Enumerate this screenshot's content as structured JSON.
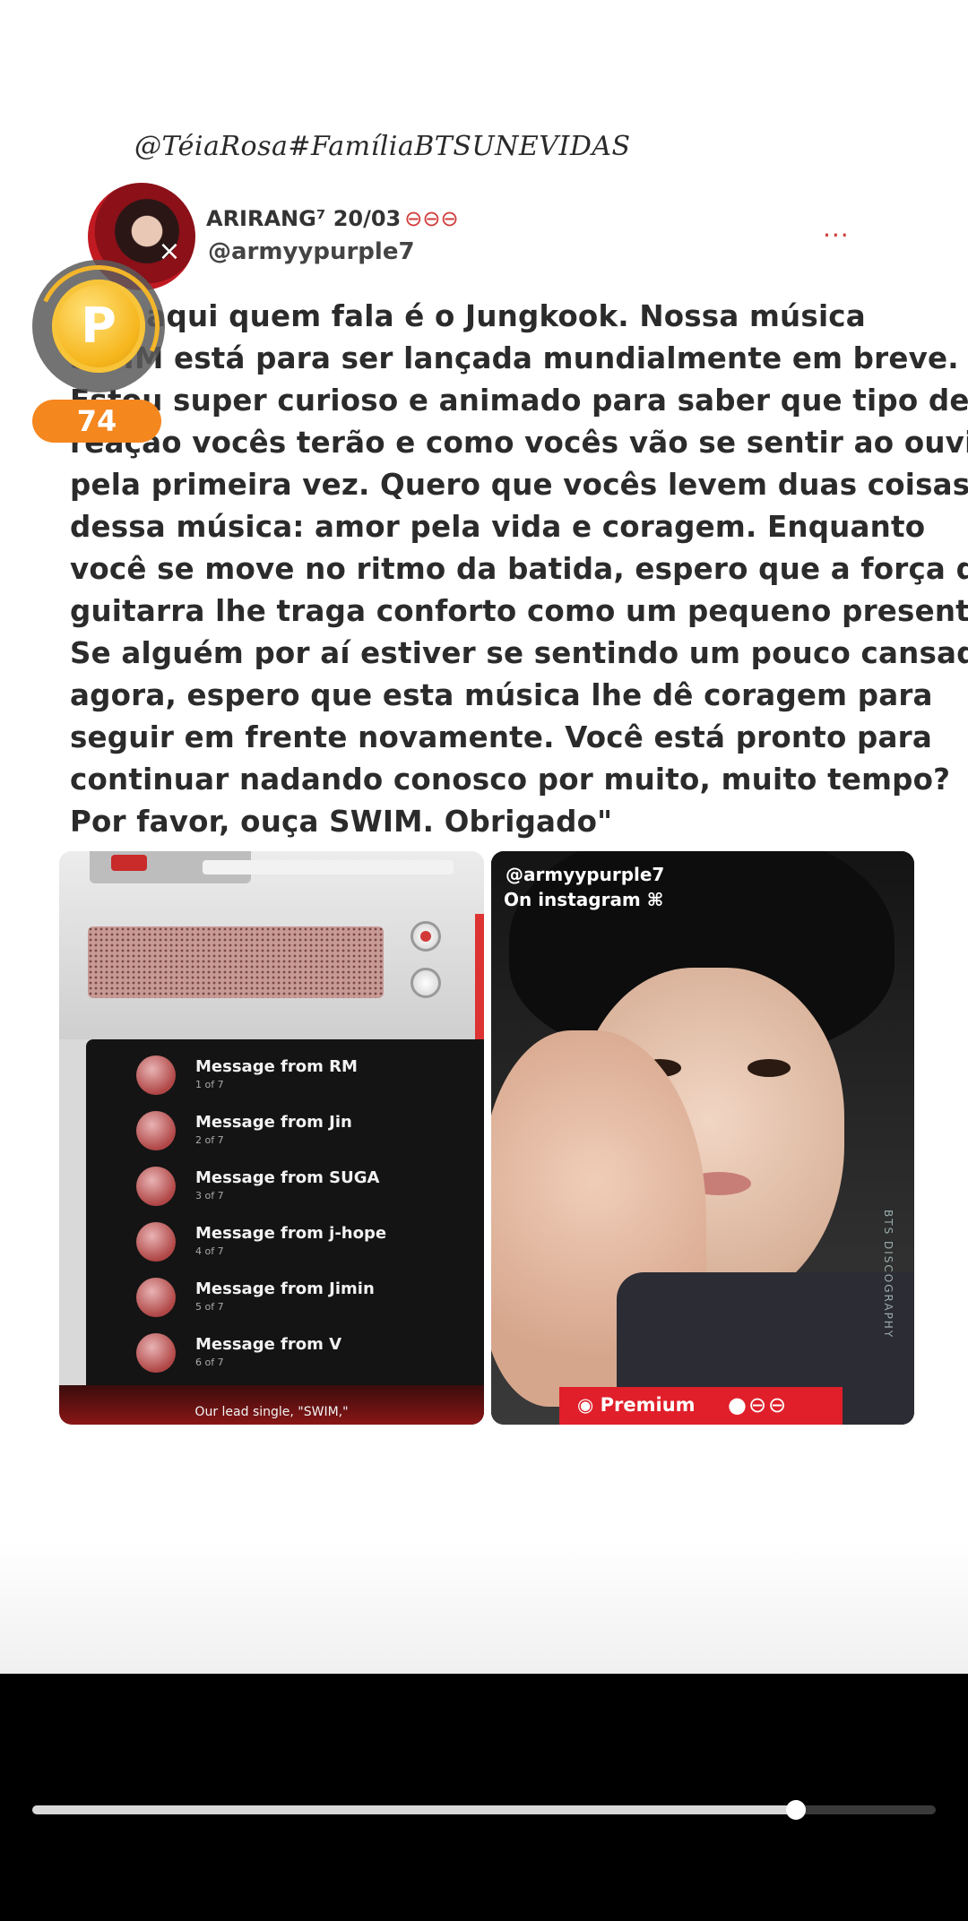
{
  "watermark": "@TéiaRosa#FamíliaBTSUNEVIDAS",
  "post": {
    "author": "ARIRANG⁷ 20/03",
    "author_emojis": "⊖⊖⊖",
    "handle": "@armyypurple7",
    "more": "...",
    "body_lines": [
      "Olá, aqui quem fala é o Jungkook. Nossa música",
      "SWIM está para ser lançada mundialmente em breve.",
      "Estou super curioso e animado para saber que tipo de",
      "reação vocês terão e como vocês vão se sentir ao ouvi-la",
      "pela primeira vez. Quero que vocês levem duas coisas",
      "dessa música: amor pela vida e coragem. Enquanto",
      "você se move no ritmo da batida, espero que a força da",
      "guitarra lhe traga conforto como um pequeno presente.",
      "Se alguém por aí estiver se sentindo um pouco cansado",
      "agora, espero que esta música lhe dê coragem para",
      "seguir em frente novamente. Você está pronto para",
      "continuar nadando conosco por muito, muito tempo?",
      "Por favor, ouça SWIM. Obrigado\""
    ]
  },
  "coin": {
    "symbol": "P",
    "count": "74"
  },
  "media_left": {
    "messages": [
      {
        "title": "Message from RM",
        "sub": "1 of 7"
      },
      {
        "title": "Message from Jin",
        "sub": "2 of 7"
      },
      {
        "title": "Message from SUGA",
        "sub": "3 of 7"
      },
      {
        "title": "Message from j-hope",
        "sub": "4 of 7"
      },
      {
        "title": "Message from Jimin",
        "sub": "5 of 7"
      },
      {
        "title": "Message from V",
        "sub": "6 of 7"
      }
    ],
    "footer": "Our lead single, \"SWIM,\""
  },
  "media_right": {
    "handle": "@armyypurple7",
    "subtitle": "On instagram ⌘",
    "premium": "Premium",
    "premium_icons": "●⊖⊖",
    "vertical": "BTS DISCOGRAPHY"
  },
  "player": {
    "progress_fraction": 0.845
  },
  "colors": {
    "accent_red": "#d23a3a",
    "coin_orange": "#f5871f",
    "premium_red": "#e01f2a"
  }
}
